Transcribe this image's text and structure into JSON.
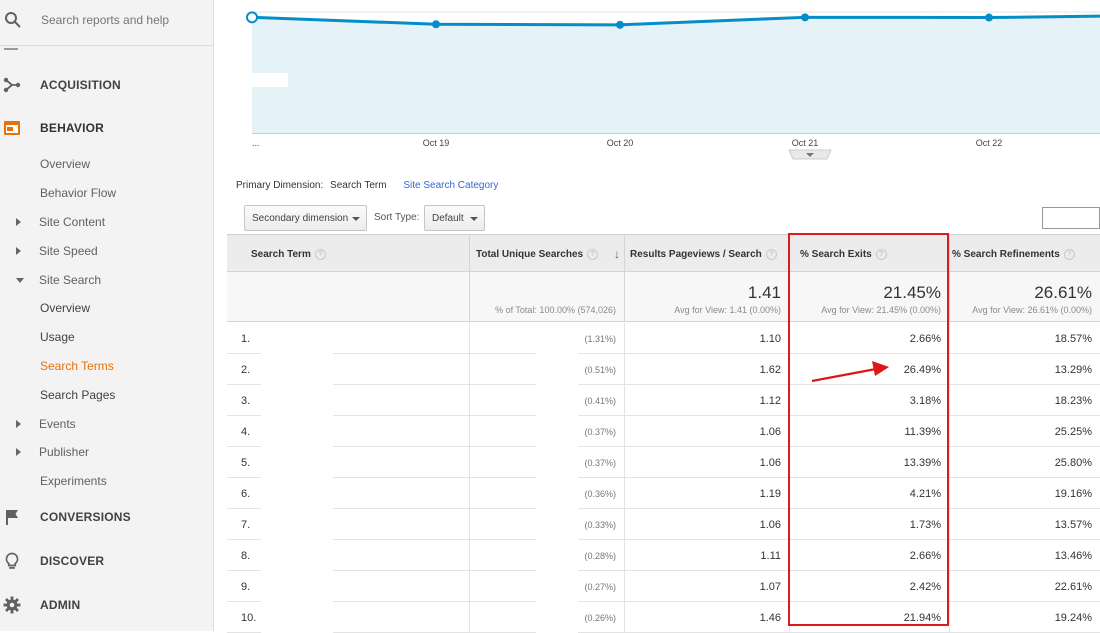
{
  "search": {
    "placeholder": "Search reports and help"
  },
  "nav": {
    "sections": {
      "acquisition": "ACQUISITION",
      "behavior": "BEHAVIOR",
      "conversions": "CONVERSIONS",
      "discover": "DISCOVER",
      "admin": "ADMIN"
    },
    "behavior_items": {
      "overview": "Overview",
      "behavior_flow": "Behavior Flow",
      "site_content": "Site Content",
      "site_speed": "Site Speed",
      "site_search": "Site Search",
      "ss_overview": "Overview",
      "ss_usage": "Usage",
      "ss_search_terms": "Search Terms",
      "ss_search_pages": "Search Pages",
      "events": "Events",
      "publisher": "Publisher",
      "experiments": "Experiments"
    }
  },
  "chart": {
    "legend": "Total Unique Searches",
    "x_labels": [
      "...",
      "Oct 19",
      "Oct 20",
      "Oct 21",
      "Oct 22"
    ]
  },
  "chart_data": {
    "type": "line",
    "series": [
      {
        "name": "Total Unique Searches",
        "values": [
          100,
          94,
          93.5,
          100,
          99.8,
          101
        ]
      }
    ],
    "x": [
      "...",
      "Oct 19",
      "Oct 20",
      "Oct 21",
      "Oct 22",
      ""
    ],
    "xlabel": "",
    "ylabel": "",
    "grid": true
  },
  "dimension": {
    "label": "Primary Dimension:",
    "current": "Search Term",
    "alternate": "Site Search Category"
  },
  "controls": {
    "secondary": "Secondary dimension",
    "sort_label": "Sort Type:",
    "sort_value": "Default"
  },
  "table": {
    "headers": {
      "term": "Search Term",
      "unique": "Total Unique Searches",
      "pageviews": "Results Pageviews / Search",
      "exits": "% Search Exits",
      "refinements": "% Search Refinements"
    },
    "help_glyph": "?",
    "sort_glyph": "↓",
    "totals": {
      "unique_sub": "% of Total: 100.00% (574,026)",
      "pageviews": "1.41",
      "pageviews_sub": "Avg for View: 1.41 (0.00%)",
      "exits": "21.45%",
      "exits_sub": "Avg for View: 21.45% (0.00%)",
      "refinements": "26.61%",
      "refinements_sub": "Avg for View: 26.61% (0.00%)"
    },
    "rows": [
      {
        "idx": "1.",
        "share": "(1.31%)",
        "pv": "1.10",
        "exits": "2.66%",
        "ref": "18.57%"
      },
      {
        "idx": "2.",
        "share": "(0.51%)",
        "pv": "1.62",
        "exits": "26.49%",
        "ref": "13.29%"
      },
      {
        "idx": "3.",
        "share": "(0.41%)",
        "pv": "1.12",
        "exits": "3.18%",
        "ref": "18.23%"
      },
      {
        "idx": "4.",
        "share": "(0.37%)",
        "pv": "1.06",
        "exits": "11.39%",
        "ref": "25.25%"
      },
      {
        "idx": "5.",
        "share": "(0.37%)",
        "pv": "1.06",
        "exits": "13.39%",
        "ref": "25.80%"
      },
      {
        "idx": "6.",
        "share": "(0.36%)",
        "pv": "1.19",
        "exits": "4.21%",
        "ref": "19.16%"
      },
      {
        "idx": "7.",
        "share": "(0.33%)",
        "pv": "1.06",
        "exits": "1.73%",
        "ref": "13.57%"
      },
      {
        "idx": "8.",
        "share": "(0.28%)",
        "pv": "1.11",
        "exits": "2.66%",
        "ref": "13.46%"
      },
      {
        "idx": "9.",
        "share": "(0.27%)",
        "pv": "1.07",
        "exits": "2.42%",
        "ref": "22.61%"
      },
      {
        "idx": "10.",
        "share": "(0.26%)",
        "pv": "1.46",
        "exits": "21.94%",
        "ref": "19.24%"
      }
    ]
  },
  "colors": {
    "accent": "#e8710a",
    "line": "#058dc7",
    "area": "#e5f3f9",
    "highlight": "#d91c1c",
    "link": "#3367d6"
  }
}
